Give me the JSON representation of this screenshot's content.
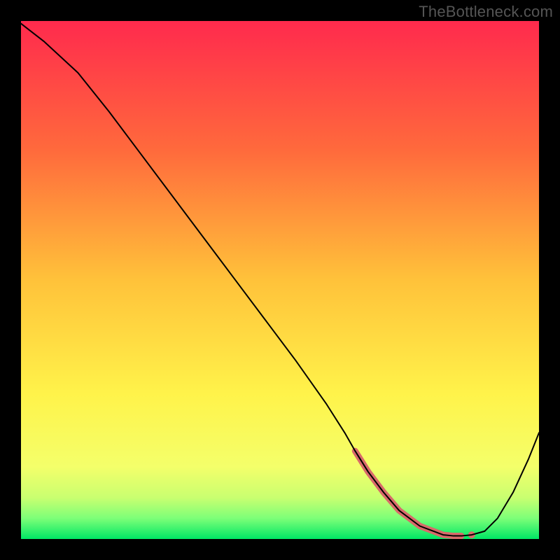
{
  "watermark": "TheBottleneck.com",
  "chart_data": {
    "type": "line",
    "title": "",
    "xlabel": "",
    "ylabel": "",
    "xlim": [
      0,
      100
    ],
    "ylim": [
      0,
      100
    ],
    "background_gradient_stops": [
      {
        "offset": 0.0,
        "color": "#ff2a4d"
      },
      {
        "offset": 0.25,
        "color": "#ff6a3c"
      },
      {
        "offset": 0.5,
        "color": "#ffc23a"
      },
      {
        "offset": 0.72,
        "color": "#fff34a"
      },
      {
        "offset": 0.86,
        "color": "#f4ff6a"
      },
      {
        "offset": 0.92,
        "color": "#c9ff70"
      },
      {
        "offset": 0.96,
        "color": "#7dff78"
      },
      {
        "offset": 1.0,
        "color": "#00e765"
      }
    ],
    "series": [
      {
        "name": "curve",
        "color": "#000000",
        "stroke_width": 2.0,
        "x": [
          0.0,
          4.5,
          11.0,
          17.0,
          23.0,
          29.0,
          35.0,
          41.0,
          47.0,
          53.0,
          59.0,
          62.5,
          64.5,
          67.0,
          70.0,
          73.0,
          77.0,
          81.5,
          83.5,
          85.0,
          87.0,
          89.5,
          92.0,
          95.0,
          98.0,
          100.0
        ],
        "y": [
          99.5,
          96.0,
          90.0,
          82.5,
          74.5,
          66.5,
          58.5,
          50.5,
          42.5,
          34.5,
          26.0,
          20.5,
          17.0,
          13.0,
          9.0,
          5.5,
          2.5,
          0.8,
          0.6,
          0.6,
          0.8,
          1.5,
          4.0,
          9.0,
          15.5,
          20.5
        ]
      }
    ],
    "highlight": {
      "name": "min-band",
      "color": "#d86a6a",
      "stroke_width": 9.0,
      "dot_radius": 5.0,
      "x": [
        64.5,
        67.0,
        70.0,
        73.0,
        77.0,
        81.5,
        83.5,
        85.0
      ],
      "y": [
        17.0,
        13.0,
        9.0,
        5.5,
        2.5,
        0.8,
        0.6,
        0.6
      ],
      "end_dot": {
        "x": 87.0,
        "y": 0.8
      }
    }
  }
}
